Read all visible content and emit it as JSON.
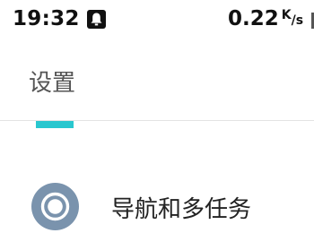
{
  "status_bar": {
    "time": "19:32",
    "notification_icon": "bell-icon",
    "net_speed_value": "0.22",
    "net_speed_unit_top": "K",
    "net_speed_unit_bottom": "s"
  },
  "header": {
    "title": "设置"
  },
  "tabs": {
    "indicator_color": "#29c7cf"
  },
  "list": {
    "items": [
      {
        "label": "导航和多任务",
        "icon": "navigation-circle-icon",
        "icon_color": "#7a93ad"
      }
    ]
  }
}
